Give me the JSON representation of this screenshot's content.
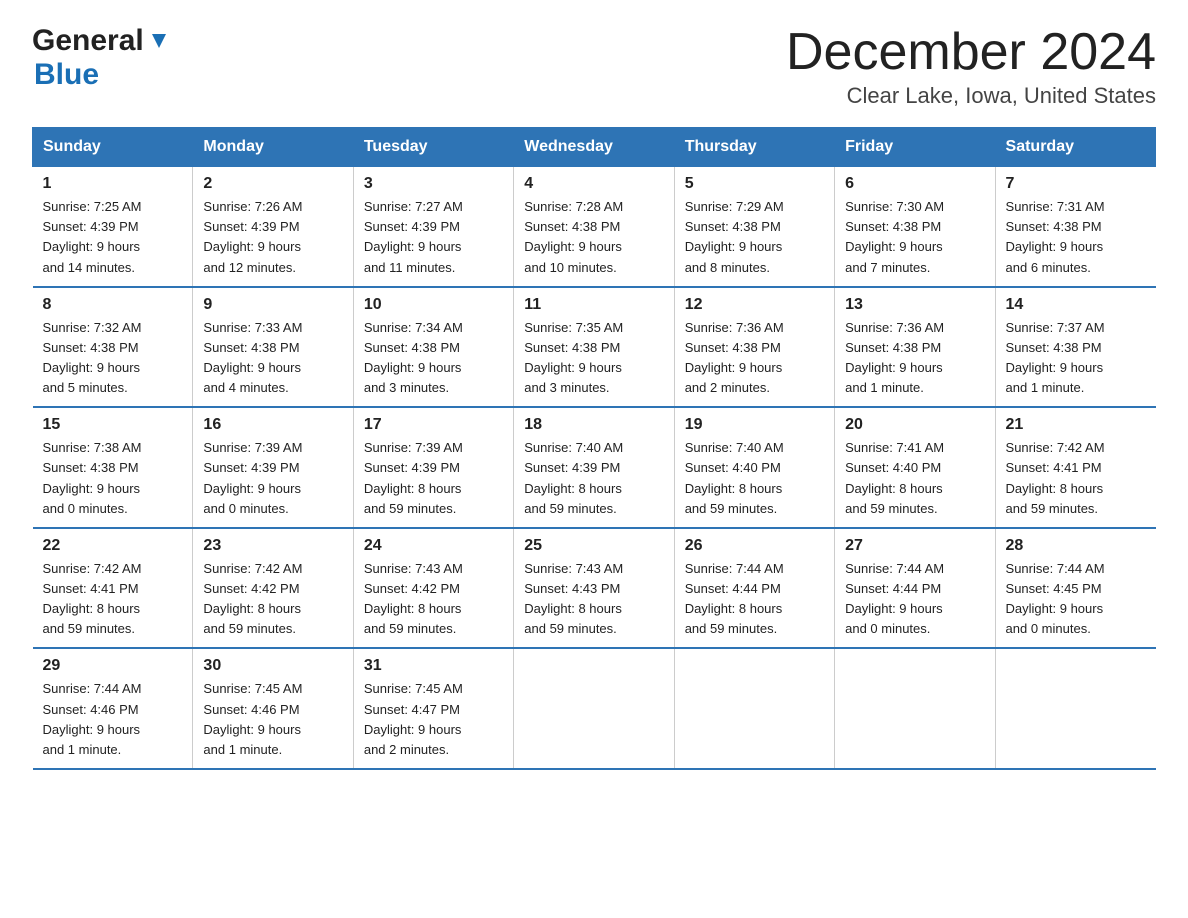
{
  "header": {
    "title": "December 2024",
    "subtitle": "Clear Lake, Iowa, United States",
    "logo_general": "General",
    "logo_blue": "Blue"
  },
  "days_of_week": [
    "Sunday",
    "Monday",
    "Tuesday",
    "Wednesday",
    "Thursday",
    "Friday",
    "Saturday"
  ],
  "weeks": [
    [
      {
        "day": "1",
        "sunrise": "7:25 AM",
        "sunset": "4:39 PM",
        "daylight": "9 hours and 14 minutes."
      },
      {
        "day": "2",
        "sunrise": "7:26 AM",
        "sunset": "4:39 PM",
        "daylight": "9 hours and 12 minutes."
      },
      {
        "day": "3",
        "sunrise": "7:27 AM",
        "sunset": "4:39 PM",
        "daylight": "9 hours and 11 minutes."
      },
      {
        "day": "4",
        "sunrise": "7:28 AM",
        "sunset": "4:38 PM",
        "daylight": "9 hours and 10 minutes."
      },
      {
        "day": "5",
        "sunrise": "7:29 AM",
        "sunset": "4:38 PM",
        "daylight": "9 hours and 8 minutes."
      },
      {
        "day": "6",
        "sunrise": "7:30 AM",
        "sunset": "4:38 PM",
        "daylight": "9 hours and 7 minutes."
      },
      {
        "day": "7",
        "sunrise": "7:31 AM",
        "sunset": "4:38 PM",
        "daylight": "9 hours and 6 minutes."
      }
    ],
    [
      {
        "day": "8",
        "sunrise": "7:32 AM",
        "sunset": "4:38 PM",
        "daylight": "9 hours and 5 minutes."
      },
      {
        "day": "9",
        "sunrise": "7:33 AM",
        "sunset": "4:38 PM",
        "daylight": "9 hours and 4 minutes."
      },
      {
        "day": "10",
        "sunrise": "7:34 AM",
        "sunset": "4:38 PM",
        "daylight": "9 hours and 3 minutes."
      },
      {
        "day": "11",
        "sunrise": "7:35 AM",
        "sunset": "4:38 PM",
        "daylight": "9 hours and 3 minutes."
      },
      {
        "day": "12",
        "sunrise": "7:36 AM",
        "sunset": "4:38 PM",
        "daylight": "9 hours and 2 minutes."
      },
      {
        "day": "13",
        "sunrise": "7:36 AM",
        "sunset": "4:38 PM",
        "daylight": "9 hours and 1 minute."
      },
      {
        "day": "14",
        "sunrise": "7:37 AM",
        "sunset": "4:38 PM",
        "daylight": "9 hours and 1 minute."
      }
    ],
    [
      {
        "day": "15",
        "sunrise": "7:38 AM",
        "sunset": "4:38 PM",
        "daylight": "9 hours and 0 minutes."
      },
      {
        "day": "16",
        "sunrise": "7:39 AM",
        "sunset": "4:39 PM",
        "daylight": "9 hours and 0 minutes."
      },
      {
        "day": "17",
        "sunrise": "7:39 AM",
        "sunset": "4:39 PM",
        "daylight": "8 hours and 59 minutes."
      },
      {
        "day": "18",
        "sunrise": "7:40 AM",
        "sunset": "4:39 PM",
        "daylight": "8 hours and 59 minutes."
      },
      {
        "day": "19",
        "sunrise": "7:40 AM",
        "sunset": "4:40 PM",
        "daylight": "8 hours and 59 minutes."
      },
      {
        "day": "20",
        "sunrise": "7:41 AM",
        "sunset": "4:40 PM",
        "daylight": "8 hours and 59 minutes."
      },
      {
        "day": "21",
        "sunrise": "7:42 AM",
        "sunset": "4:41 PM",
        "daylight": "8 hours and 59 minutes."
      }
    ],
    [
      {
        "day": "22",
        "sunrise": "7:42 AM",
        "sunset": "4:41 PM",
        "daylight": "8 hours and 59 minutes."
      },
      {
        "day": "23",
        "sunrise": "7:42 AM",
        "sunset": "4:42 PM",
        "daylight": "8 hours and 59 minutes."
      },
      {
        "day": "24",
        "sunrise": "7:43 AM",
        "sunset": "4:42 PM",
        "daylight": "8 hours and 59 minutes."
      },
      {
        "day": "25",
        "sunrise": "7:43 AM",
        "sunset": "4:43 PM",
        "daylight": "8 hours and 59 minutes."
      },
      {
        "day": "26",
        "sunrise": "7:44 AM",
        "sunset": "4:44 PM",
        "daylight": "8 hours and 59 minutes."
      },
      {
        "day": "27",
        "sunrise": "7:44 AM",
        "sunset": "4:44 PM",
        "daylight": "9 hours and 0 minutes."
      },
      {
        "day": "28",
        "sunrise": "7:44 AM",
        "sunset": "4:45 PM",
        "daylight": "9 hours and 0 minutes."
      }
    ],
    [
      {
        "day": "29",
        "sunrise": "7:44 AM",
        "sunset": "4:46 PM",
        "daylight": "9 hours and 1 minute."
      },
      {
        "day": "30",
        "sunrise": "7:45 AM",
        "sunset": "4:46 PM",
        "daylight": "9 hours and 1 minute."
      },
      {
        "day": "31",
        "sunrise": "7:45 AM",
        "sunset": "4:47 PM",
        "daylight": "9 hours and 2 minutes."
      },
      null,
      null,
      null,
      null
    ]
  ],
  "labels": {
    "sunrise": "Sunrise:",
    "sunset": "Sunset:",
    "daylight": "Daylight:"
  }
}
